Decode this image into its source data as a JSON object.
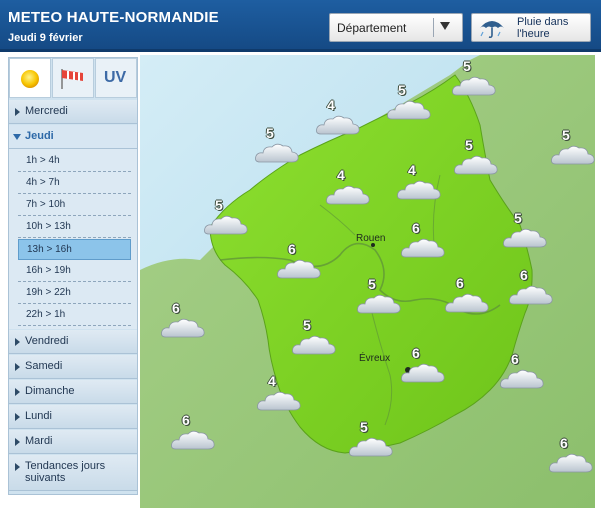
{
  "header": {
    "title": "METEO HAUTE-NORMANDIE",
    "date": "Jeudi 9 février",
    "department_select": "Département",
    "rain_button": "Pluie dans l'heure"
  },
  "sidebar": {
    "icon_tabs": [
      {
        "name": "sun-icon"
      },
      {
        "name": "windsock-icon"
      },
      {
        "label": "UV"
      }
    ],
    "days_before": [
      "Mercredi"
    ],
    "open_day": "Jeudi",
    "slots": [
      "1h > 4h",
      "4h > 7h",
      "7h > 10h",
      "10h > 13h",
      "13h > 16h",
      "16h > 19h",
      "19h > 22h",
      "22h > 1h"
    ],
    "active_slot": "13h > 16h",
    "days_after": [
      "Vendredi",
      "Samedi",
      "Dimanche",
      "Lundi",
      "Mardi",
      "Tendances jours suivants"
    ]
  },
  "map": {
    "cities": [
      "Rouen",
      "Évreux"
    ],
    "stations": [
      {
        "value": "5"
      },
      {
        "value": "4"
      },
      {
        "value": "5"
      },
      {
        "value": "5"
      },
      {
        "value": "4"
      },
      {
        "value": "4"
      },
      {
        "value": "5"
      },
      {
        "value": "5"
      },
      {
        "value": "5"
      },
      {
        "value": "6"
      },
      {
        "value": "6"
      },
      {
        "value": "5"
      },
      {
        "value": "6"
      },
      {
        "value": "5"
      },
      {
        "value": "6"
      },
      {
        "value": "6"
      },
      {
        "value": "5"
      },
      {
        "value": "6"
      },
      {
        "value": "6"
      },
      {
        "value": "4"
      },
      {
        "value": "6"
      },
      {
        "value": "5"
      },
      {
        "value": "6"
      }
    ],
    "colors": {
      "region": "#7ed321",
      "sea": "#bfe3f1",
      "land": "#9ccb7c",
      "river": "#5c8f3a"
    }
  }
}
